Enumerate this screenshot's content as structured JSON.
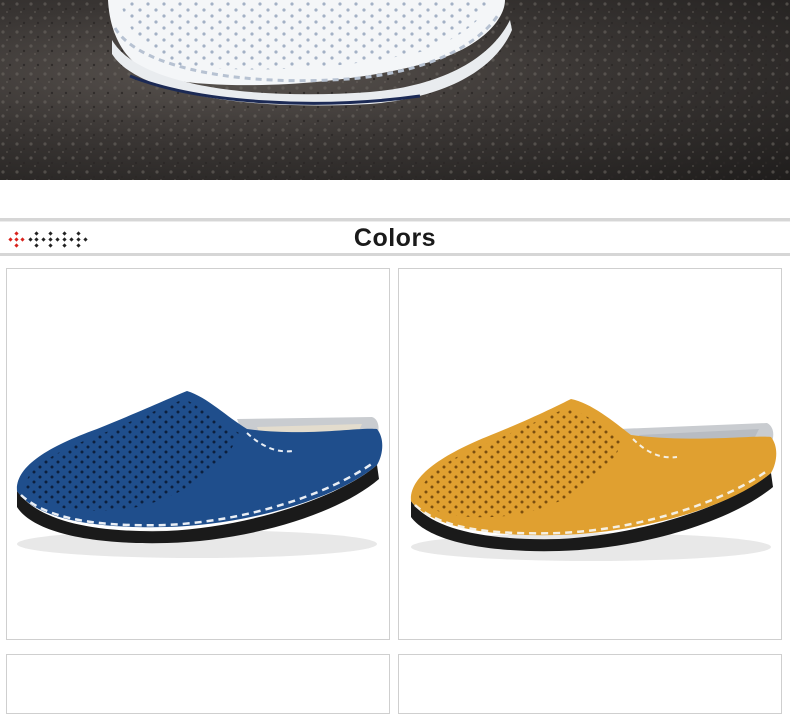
{
  "section": {
    "title": "Colors"
  },
  "products": [
    {
      "color_name": "blue",
      "accent": "#1f4e8c"
    },
    {
      "color_name": "yellow",
      "accent": "#e0a030"
    },
    {
      "color_name": "",
      "accent": "#ffffff"
    },
    {
      "color_name": "",
      "accent": "#ffffff"
    }
  ],
  "icons": {
    "header_ornament": "diamond-dots-icon"
  },
  "colors": {
    "divider": "#d6d6d6",
    "ornament_red": "#d9221c",
    "ornament_dark": "#222222"
  }
}
